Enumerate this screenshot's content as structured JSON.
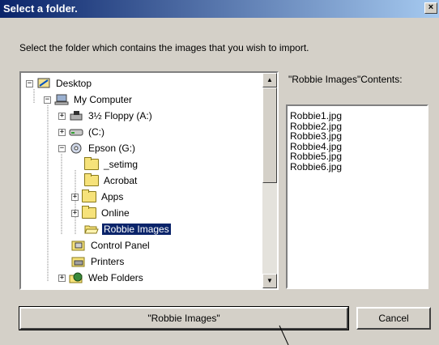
{
  "window": {
    "title": "Select a folder.",
    "close_glyph": "×"
  },
  "instruction": "Select the folder which contains the images that you wish to import.",
  "tree": {
    "items": [
      {
        "label": "Desktop",
        "icon": "desktop-icon",
        "expander": "−",
        "selected": false
      },
      {
        "label": "My Computer",
        "icon": "computer-icon",
        "expander": "−",
        "selected": false
      },
      {
        "label": "3½ Floppy (A:)",
        "icon": "floppy-icon",
        "expander": "+",
        "selected": false
      },
      {
        "label": "(C:)",
        "icon": "drive-icon",
        "expander": "+",
        "selected": false
      },
      {
        "label": "Epson (G:)",
        "icon": "cdrom-icon",
        "expander": "−",
        "selected": false
      },
      {
        "label": "_setimg",
        "icon": "folder-icon",
        "expander": "",
        "selected": false
      },
      {
        "label": "Acrobat",
        "icon": "folder-icon",
        "expander": "",
        "selected": false
      },
      {
        "label": "Apps",
        "icon": "folder-icon",
        "expander": "+",
        "selected": false
      },
      {
        "label": "Online",
        "icon": "folder-icon",
        "expander": "+",
        "selected": false
      },
      {
        "label": "Robbie Images",
        "icon": "open-folder-icon",
        "expander": "",
        "selected": true
      },
      {
        "label": "Control Panel",
        "icon": "control-panel-icon",
        "expander": "",
        "selected": false
      },
      {
        "label": "Printers",
        "icon": "printers-icon",
        "expander": "",
        "selected": false
      },
      {
        "label": "Web Folders",
        "icon": "web-folders-icon",
        "expander": "+",
        "selected": false
      }
    ]
  },
  "scrollbar": {
    "up_glyph": "▲",
    "down_glyph": "▼"
  },
  "contents": {
    "label": "\"Robbie Images\"Contents:",
    "files": [
      "Robbie1.jpg",
      "Robbie2.jpg",
      "Robbie3.jpg",
      "Robbie4.jpg",
      "Robbie5.jpg",
      "Robbie6.jpg"
    ]
  },
  "buttons": {
    "select_label": "\"Robbie Images\"",
    "cancel_label": "Cancel"
  },
  "colors": {
    "title_bar_start": "#0a246a",
    "title_bar_end": "#a6caf0",
    "dialog_bg": "#d4d0c8",
    "selection": "#0a246a"
  }
}
